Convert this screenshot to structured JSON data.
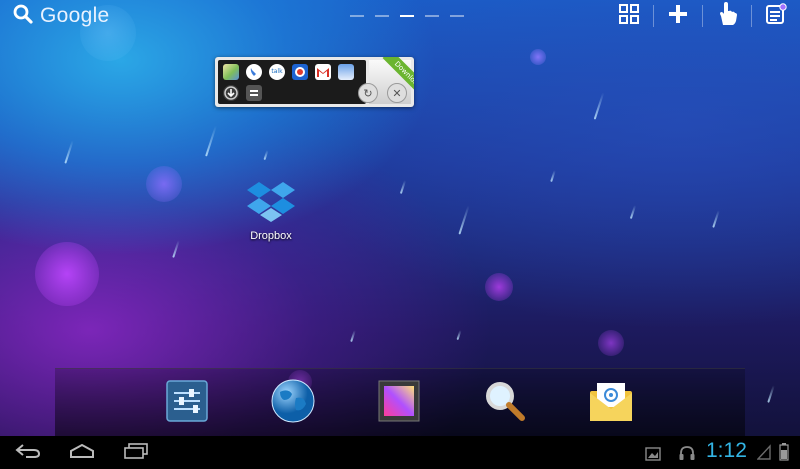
{
  "search": {
    "label": "Google"
  },
  "pages": {
    "count": 5,
    "active_index": 2
  },
  "widget": {
    "ribbon_text": "Download",
    "icons": [
      "maps-icon",
      "google-voice-icon",
      "talk-icon",
      "latitude-icon",
      "gmail-icon",
      "calendar-icon",
      "download-arrow-icon",
      "equals-icon"
    ]
  },
  "desktop": {
    "apps": [
      {
        "label": "Dropbox"
      }
    ]
  },
  "dock": {
    "items": [
      "settings-icon",
      "browser-icon",
      "gallery-icon",
      "search-icon",
      "email-icon"
    ]
  },
  "status": {
    "time": "1:12"
  },
  "colors": {
    "accent": "#33b5e5",
    "widget_ribbon": "#6bb530"
  }
}
